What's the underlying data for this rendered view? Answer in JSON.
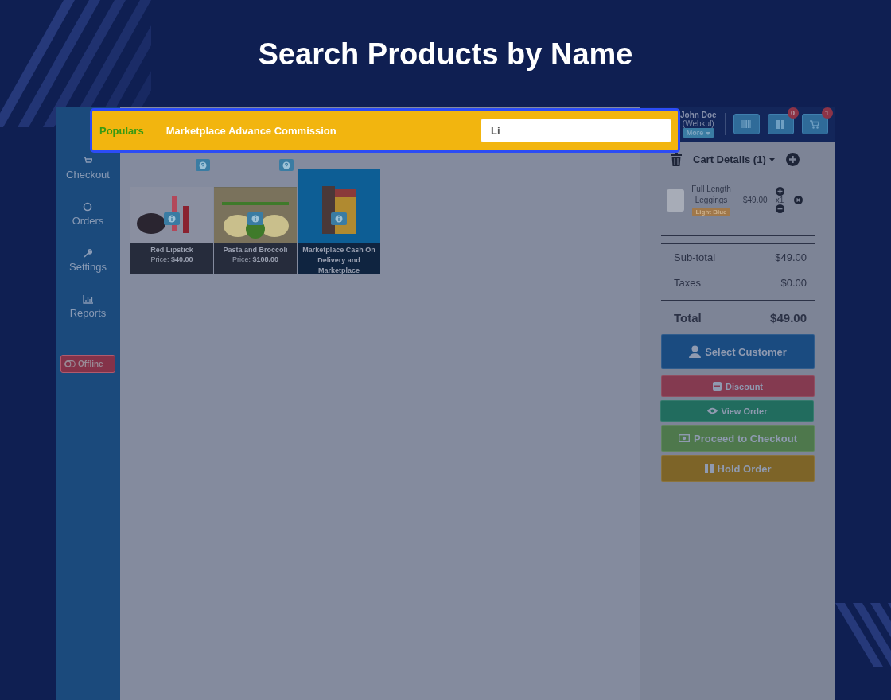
{
  "page_title": "Search Products by Name",
  "sidebar": {
    "items": [
      {
        "label": "Checkout",
        "kind": "cart"
      },
      {
        "label": "Orders",
        "kind": "circle"
      },
      {
        "label": "Settings",
        "kind": "wrench"
      },
      {
        "label": "Reports",
        "kind": "chart"
      }
    ],
    "status_button": "Offline"
  },
  "search_bar": {
    "tabs": [
      {
        "label": "Populars",
        "selected": true
      },
      {
        "label": "Marketplace Advance Commission",
        "selected": false
      }
    ],
    "value": "Li"
  },
  "products": [
    {
      "name": "Red Lipstick",
      "price": "Price: **$40.00**",
      "kind": "lipstick",
      "help": true
    },
    {
      "name": "Pasta and Broccoli",
      "price": "Price: **$108.00**",
      "kind": "food",
      "help": true
    },
    {
      "name": "Marketplace Cash On Delivery and Marketplace",
      "kind": "door",
      "help": false
    }
  ],
  "header": {
    "user_name": "John Doe",
    "user_org": "(Webkul)",
    "more_button": "More",
    "buttons": [
      {
        "kind": "barcode"
      },
      {
        "kind": "pause",
        "badge": "0"
      },
      {
        "kind": "cart",
        "badge": "1"
      }
    ]
  },
  "cart": {
    "title": "Cart Details (1)",
    "items": [
      {
        "name": "Full Length Leggings",
        "variant": "Light Blue",
        "price": "$49.00",
        "quantity": "x1"
      }
    ],
    "subtotal_label": "Sub-total",
    "subtotal": "$49.00",
    "taxes_label": "Taxes",
    "taxes": "$0.00",
    "total_label": "Total",
    "total": "$49.00"
  },
  "actions": [
    {
      "label": "Select Customer",
      "kind": "customer"
    },
    {
      "label": "Discount",
      "kind": "discount"
    },
    {
      "label": "View Order",
      "kind": "view"
    },
    {
      "label": "Proceed to Checkout",
      "kind": "checkout"
    },
    {
      "label": "Hold Order",
      "kind": "hold"
    }
  ]
}
